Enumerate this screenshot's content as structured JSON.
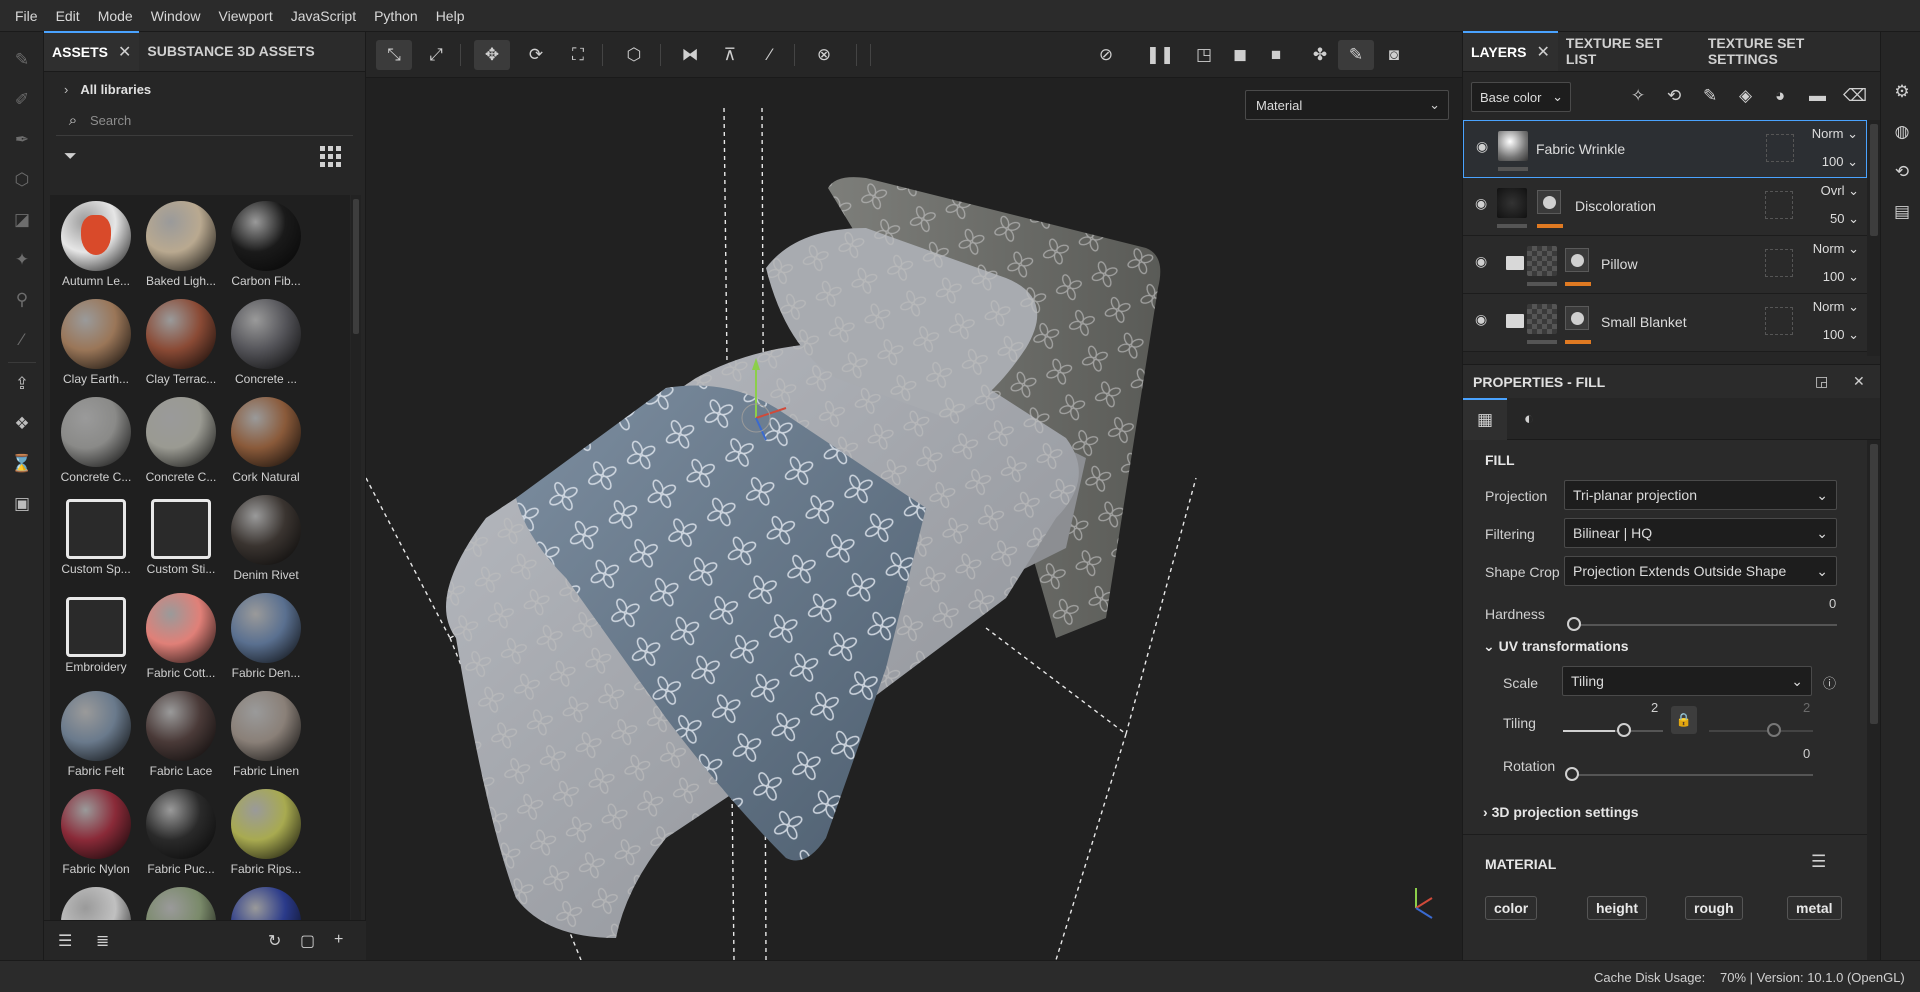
{
  "menu": [
    "File",
    "Edit",
    "Mode",
    "Window",
    "Viewport",
    "JavaScript",
    "Python",
    "Help"
  ],
  "assets_panel": {
    "tabs": [
      "ASSETS",
      "SUBSTANCE 3D ASSETS"
    ],
    "close_glyph": "✕",
    "library": "All libraries",
    "search_placeholder": "Search",
    "items": [
      {
        "label": "Autumn Le...",
        "color": "#e6e6e6",
        "accent": "#d94a2a"
      },
      {
        "label": "Baked Ligh...",
        "color": "#b9a990"
      },
      {
        "label": "Carbon Fib...",
        "color": "#1a1a1a"
      },
      {
        "label": "Clay Earth...",
        "color": "#9a7658"
      },
      {
        "label": "Clay Terrac...",
        "color": "#8a4a35"
      },
      {
        "label": "Concrete ...",
        "color": "#55555a"
      },
      {
        "label": "Concrete C...",
        "color": "#8a8a88"
      },
      {
        "label": "Concrete C...",
        "color": "#9a9a92"
      },
      {
        "label": "Cork Natural",
        "color": "#8a5a3a"
      },
      {
        "label": "Custom Sp...",
        "color": "#2a2a2a",
        "icon": true
      },
      {
        "label": "Custom Sti...",
        "color": "#2a2a2a",
        "icon": true
      },
      {
        "label": "Denim Rivet",
        "color": "#3a3430"
      },
      {
        "label": "Embroidery",
        "color": "#2a2a2a",
        "icon": true
      },
      {
        "label": "Fabric Cott...",
        "color": "#e08078"
      },
      {
        "label": "Fabric Den...",
        "color": "#5a7090"
      },
      {
        "label": "Fabric Felt",
        "color": "#6a7a8c"
      },
      {
        "label": "Fabric Lace",
        "color": "#4a3a38"
      },
      {
        "label": "Fabric Linen",
        "color": "#8a8078"
      },
      {
        "label": "Fabric Nylon",
        "color": "#8a2a38"
      },
      {
        "label": "Fabric Puc...",
        "color": "#2a2a2a"
      },
      {
        "label": "Fabric Rips...",
        "color": "#a8aa50"
      },
      {
        "label": "",
        "color": "#c0c0c0"
      },
      {
        "label": "",
        "color": "#7a8a6a"
      },
      {
        "label": "",
        "color": "#2a3a8a"
      }
    ]
  },
  "viewport": {
    "material_dropdown": "Material"
  },
  "right_panel": {
    "tabs": [
      "LAYERS",
      "TEXTURE SET LIST",
      "TEXTURE SET SETTINGS"
    ],
    "close_glyph": "✕",
    "channel_select": "Base color",
    "layers": [
      {
        "name": "Fabric Wrinkle",
        "blend": "Norm",
        "opacity": "100"
      },
      {
        "name": "Discoloration",
        "blend": "Ovrl",
        "opacity": "50"
      },
      {
        "name": "Pillow",
        "blend": "Norm",
        "opacity": "100"
      },
      {
        "name": "Small Blanket",
        "blend": "Norm",
        "opacity": "100"
      }
    ],
    "properties_title": "PROPERTIES - FILL",
    "fill": {
      "section": "FILL",
      "projection_label": "Projection",
      "projection": "Tri-planar projection",
      "filtering_label": "Filtering",
      "filtering": "Bilinear | HQ",
      "shapecrop_label": "Shape Crop",
      "shapecrop": "Projection Extends Outside Shape",
      "hardness_label": "Hardness",
      "hardness": "0",
      "uv_title": "UV transformations",
      "scale_label": "Scale",
      "scale": "Tiling",
      "tiling_label": "Tiling",
      "tiling": "2",
      "tiling2": "2",
      "rotation_label": "Rotation",
      "rotation": "0",
      "proj3d": "3D projection settings",
      "material_title": "MATERIAL",
      "chips": [
        "color",
        "height",
        "rough",
        "metal"
      ]
    }
  },
  "status": {
    "cache": "Cache Disk Usage:",
    "version": "70% | Version: 10.1.0 (OpenGL)"
  }
}
